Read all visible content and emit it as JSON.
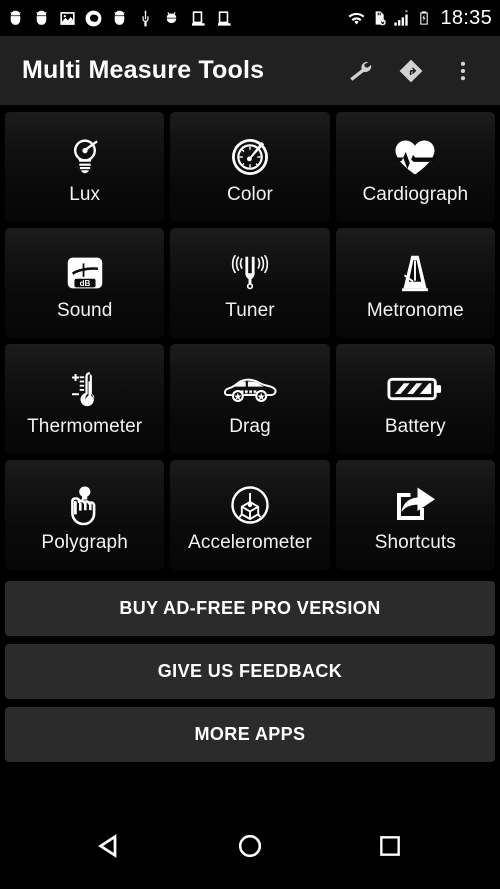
{
  "statusbar": {
    "time": "18:35",
    "left_icons": [
      {
        "name": "android-sync-icon"
      },
      {
        "name": "android-sync-icon"
      },
      {
        "name": "image-icon"
      },
      {
        "name": "record-dot-icon"
      },
      {
        "name": "android-sync-icon"
      },
      {
        "name": "usb-icon"
      },
      {
        "name": "debug-bug-icon"
      },
      {
        "name": "app-install-check-icon"
      },
      {
        "name": "play-store-icon"
      }
    ],
    "right_icons": [
      {
        "name": "wifi-icon"
      },
      {
        "name": "sd-card-off-icon"
      },
      {
        "name": "signal-bars-icon"
      },
      {
        "name": "battery-charging-icon"
      }
    ]
  },
  "appbar": {
    "title": "Multi Measure Tools",
    "actions": [
      {
        "name": "wrench-icon",
        "label": "Settings"
      },
      {
        "name": "road-sign-icon",
        "label": "Directions"
      },
      {
        "name": "overflow-menu-icon",
        "label": "More options"
      }
    ]
  },
  "tools": [
    [
      {
        "label": "Lux",
        "icon": "lightbulb-gauge-icon"
      },
      {
        "label": "Color",
        "icon": "color-wheel-icon"
      },
      {
        "label": "Cardiograph",
        "icon": "heart-pulse-icon"
      }
    ],
    [
      {
        "label": "Sound",
        "icon": "decibel-meter-icon"
      },
      {
        "label": "Tuner",
        "icon": "tuning-fork-icon"
      },
      {
        "label": "Metronome",
        "icon": "metronome-icon"
      }
    ],
    [
      {
        "label": "Thermometer",
        "icon": "thermometer-icon"
      },
      {
        "label": "Drag",
        "icon": "car-icon"
      },
      {
        "label": "Battery",
        "icon": "battery-icon"
      }
    ],
    [
      {
        "label": "Polygraph",
        "icon": "hand-touch-icon"
      },
      {
        "label": "Accelerometer",
        "icon": "axis-cube-icon"
      },
      {
        "label": "Shortcuts",
        "icon": "share-export-icon"
      }
    ]
  ],
  "actions": [
    {
      "label": "BUY AD-FREE PRO VERSION",
      "name": "buy-pro-button"
    },
    {
      "label": "GIVE US FEEDBACK",
      "name": "feedback-button"
    },
    {
      "label": "MORE APPS",
      "name": "more-apps-button"
    }
  ],
  "navbar": [
    {
      "name": "back-button"
    },
    {
      "name": "home-button"
    },
    {
      "name": "recents-button"
    }
  ],
  "colors": {
    "background": "#000000",
    "appbar": "#212121",
    "tile": "#141414",
    "action_button": "#2b2b2b",
    "text": "#ffffff"
  }
}
